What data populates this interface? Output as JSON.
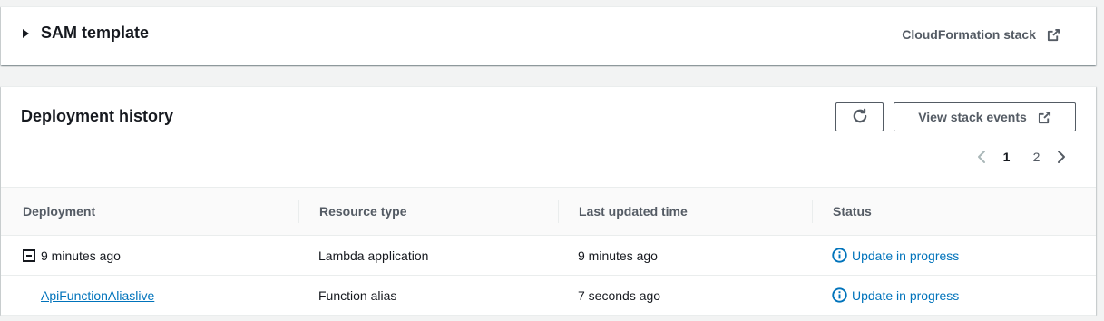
{
  "sam_section": {
    "title": "SAM template",
    "cloudformation_link": "CloudFormation stack"
  },
  "deployment_history": {
    "title": "Deployment history",
    "view_stack_events": "View stack events",
    "pagination": {
      "pages": [
        "1",
        "2"
      ],
      "current": "1"
    },
    "columns": [
      "Deployment",
      "Resource type",
      "Last updated time",
      "Status"
    ],
    "rows": [
      {
        "deployment": "9 minutes ago",
        "resource_type": "Lambda application",
        "last_updated": "9 minutes ago",
        "status": "Update in progress"
      },
      {
        "deployment": "ApiFunctionAliaslive",
        "resource_type": "Function alias",
        "last_updated": "7 seconds ago",
        "status": "Update in progress"
      }
    ]
  },
  "colors": {
    "link": "#0073bb",
    "text": "#16191f",
    "secondary": "#545b64",
    "background": "#f2f3f3"
  },
  "icons": {
    "expand": "caret-right-icon",
    "external": "external-link-icon",
    "refresh": "refresh-icon",
    "prev": "chevron-left-icon",
    "next": "chevron-right-icon",
    "collapse": "collapse-minus-icon",
    "status": "info-icon"
  }
}
